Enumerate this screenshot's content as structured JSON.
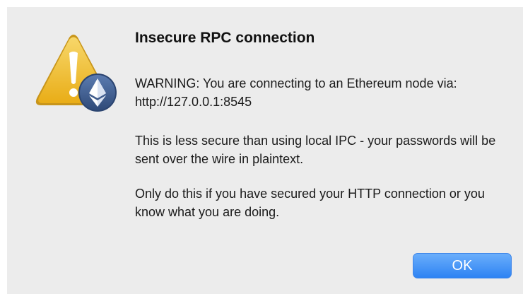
{
  "dialog": {
    "icon": "warning-triangle-with-ethereum-badge",
    "title": "Insecure RPC connection",
    "messages": [
      "WARNING: You are connecting to an Ethereum node via: http://127.0.0.1:8545",
      "This is less secure than using local IPC - your passwords will be sent over the wire in plaintext.",
      "Only do this if you have secured your HTTP connection or you know what you are doing."
    ],
    "ok_label": "OK"
  },
  "colors": {
    "dialog_background": "#ececec",
    "warning_yellow": "#f2c230",
    "ethereum_badge": "#3d5a8c",
    "button_blue": "#2e83f3"
  }
}
